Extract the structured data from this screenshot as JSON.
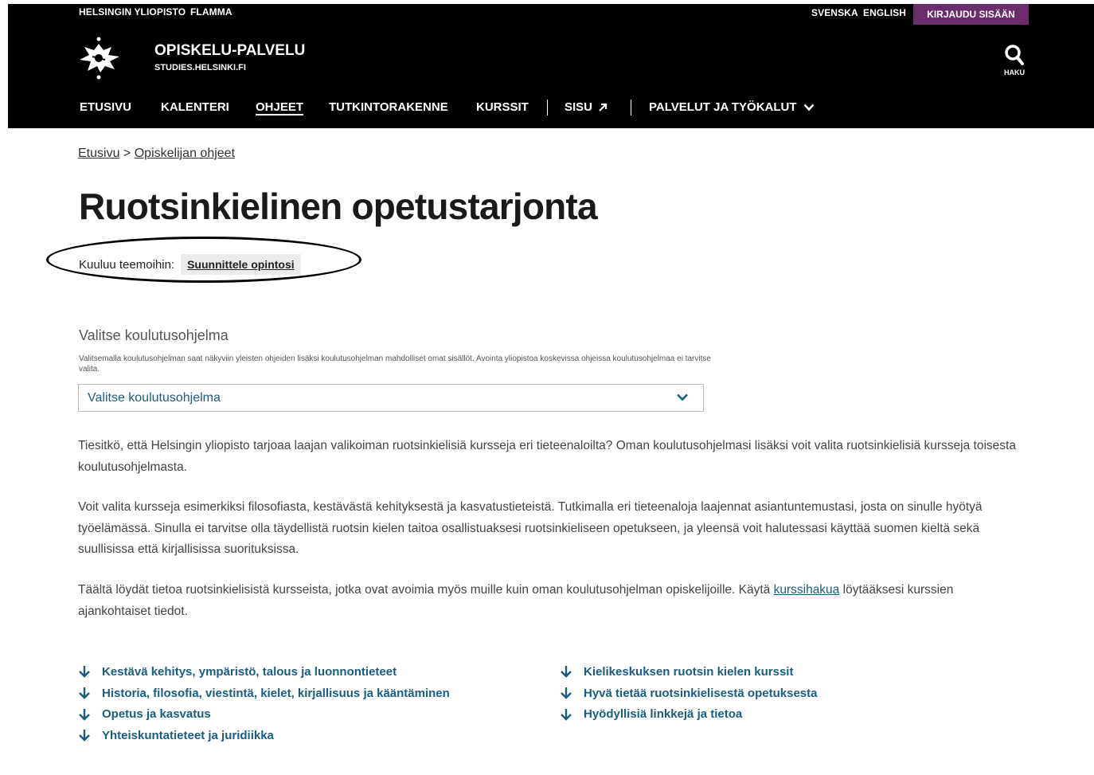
{
  "topbar": {
    "links": [
      "HELSINGIN YLIOPISTO",
      "FLAMMA"
    ],
    "languages": [
      "SVENSKA",
      "ENGLISH"
    ],
    "login_label": "KIRJAUDU SISÄÄN"
  },
  "brand": {
    "name": "OPISKELU-PALVELU",
    "url": "STUDIES.HELSINKI.FI"
  },
  "search": {
    "label": "HAKU"
  },
  "nav": {
    "items": [
      "ETUSIVU",
      "KALENTERI",
      "OHJEET",
      "TUTKINTORAKENNE",
      "KURSSIT",
      "SISU",
      "PALVELUT JA TYÖKALUT"
    ],
    "active": "OHJEET"
  },
  "breadcrumb": {
    "items": [
      "Etusivu",
      "Opiskelijan ohjeet"
    ],
    "separator": ">"
  },
  "page": {
    "title": "Ruotsinkielinen opetustarjonta",
    "themes_label": "Kuuluu teemoihin:",
    "theme_tag": "Suunnittele opintosi"
  },
  "program_select": {
    "heading": "Valitse koulutusohjelma",
    "help": "Valitsemalla koulutusohjelman saat näkyviin yleisten ohjeiden lisäksi koulutusohjelman mahdolliset omat sisällöt. Avointa yliopistoa koskevissa ohjeissa koulutusohjelmaa ei tarvitse valita.",
    "value": "Valitse koulutusohjelma"
  },
  "content": {
    "p1": "Tiesitkö, että Helsingin yliopisto tarjoaa laajan valikoiman ruotsinkielisiä kursseja eri tieteenaloilta? Oman koulutusohjelmasi lisäksi voit valita ruotsinkielisiä kursseja toisesta koulutusohjelmasta.",
    "p2": "Voit valita kursseja esimerkiksi filosofiasta, kestävästä kehityksestä ja kasvatustieteistä. Tutkimalla eri tieteenaloja laajennat asiantuntemustasi, josta on sinulle hyötyä työelämässä. Sinulla ei tarvitse olla täydellistä ruotsin kielen taitoa osallistuaksesi ruotsinkieliseen opetukseen, ja yleensä voit halutessasi käyttää suomen kieltä sekä suullisissa että kirjallisissa suorituksissa.",
    "p3_before": "Täältä löydät tietoa ruotsinkielisistä kursseista, jotka ovat avoimia myös muille kuin oman koulutusohjelman opiskelijoille. Käytä",
    "p3_link": "kurssihakua",
    "p3_after": "löytääksesi kurssien ajankohtaiset tiedot."
  },
  "anchors": {
    "left": [
      "Kestävä kehitys, ympäristö, talous ja luonnontieteet",
      "Historia, filosofia, viestintä, kielet, kirjallisuus ja kääntäminen",
      "Opetus ja kasvatus",
      "Yhteiskuntatieteet ja juridiikka"
    ],
    "right": [
      "Kielikeskuksen ruotsin kielen kurssit",
      "Hyvä tietää ruotsinkielisestä opetuksesta",
      "Hyödyllisiä linkkejä ja tietoa"
    ]
  },
  "colors": {
    "header_bg": "#000000",
    "login_bg": "#6b2c6b",
    "link": "#1a5d80"
  }
}
